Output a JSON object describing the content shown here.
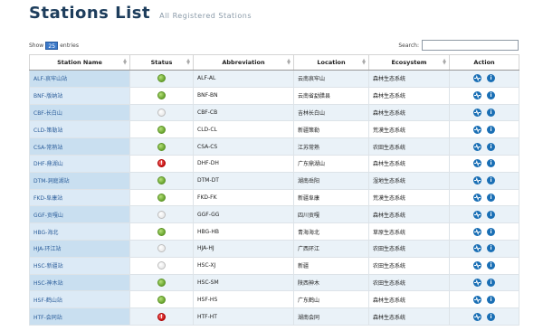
{
  "header": {
    "title": "Stations List",
    "subtitle": "All Registered Stations"
  },
  "controls": {
    "show_label": "Show",
    "page_size": "25",
    "entries_label": "entries",
    "search_label": "Search:"
  },
  "table": {
    "columns": [
      "Station Name",
      "Status",
      "Abbreviation",
      "Location",
      "Ecosystem",
      "Action"
    ],
    "rows": [
      {
        "name": "ALF-哀牢山站",
        "status": "green",
        "abbr": "ALF-AL",
        "location": "云南哀牢山",
        "ecosystem": "森林生态系统"
      },
      {
        "name": "BNF-版纳站",
        "status": "green",
        "abbr": "BNF-BN",
        "location": "云南省勐腊县",
        "ecosystem": "森林生态系统"
      },
      {
        "name": "CBF-长白山",
        "status": "empty",
        "abbr": "CBF-CB",
        "location": "吉林长白山",
        "ecosystem": "森林生态系统"
      },
      {
        "name": "CLD-策勒站",
        "status": "green",
        "abbr": "CLD-CL",
        "location": "新疆策勒",
        "ecosystem": "荒漠生态系统"
      },
      {
        "name": "CSA-常熟站",
        "status": "green",
        "abbr": "CSA-CS",
        "location": "江苏常熟",
        "ecosystem": "农田生态系统"
      },
      {
        "name": "DHF-鼎湖山",
        "status": "red",
        "abbr": "DHF-DH",
        "location": "广东鼎湖山",
        "ecosystem": "森林生态系统"
      },
      {
        "name": "DTM-洞庭湖站",
        "status": "green",
        "abbr": "DTM-DT",
        "location": "湖南岳阳",
        "ecosystem": "湿地生态系统"
      },
      {
        "name": "FKD-阜康站",
        "status": "green",
        "abbr": "FKD-FK",
        "location": "新疆阜康",
        "ecosystem": "荒漠生态系统"
      },
      {
        "name": "GGF-贡嘎山",
        "status": "empty",
        "abbr": "GGF-GG",
        "location": "四川贡嘎",
        "ecosystem": "森林生态系统"
      },
      {
        "name": "HBG-海北",
        "status": "green",
        "abbr": "HBG-HB",
        "location": "青海海北",
        "ecosystem": "草原生态系统"
      },
      {
        "name": "HJA-环江站",
        "status": "empty",
        "abbr": "HJA-HJ",
        "location": "广西环江",
        "ecosystem": "农田生态系统"
      },
      {
        "name": "HSC-新疆站",
        "status": "empty",
        "abbr": "HSC-XJ",
        "location": "新疆",
        "ecosystem": "农田生态系统"
      },
      {
        "name": "HSC-神木站",
        "status": "green",
        "abbr": "HSC-SM",
        "location": "陕西神木",
        "ecosystem": "农田生态系统"
      },
      {
        "name": "HSF-鹤山站",
        "status": "green",
        "abbr": "HSF-HS",
        "location": "广东鹤山",
        "ecosystem": "森林生态系统"
      },
      {
        "name": "HTF-会同站",
        "status": "red",
        "abbr": "HTF-HT",
        "location": "湖南会同",
        "ecosystem": "森林生态系统"
      }
    ]
  },
  "icons": {
    "status_ok": "status-ok-icon",
    "status_off": "status-off-icon",
    "status_alert": "status-alert-icon",
    "action_chart": "heartbeat-icon",
    "action_info": "info-icon"
  },
  "colors": {
    "title": "#1d3d5c",
    "link": "#2b5d9a",
    "green": "#6aa630",
    "red": "#c81414",
    "action": "#1a6fb5",
    "select": "#3b79c9"
  }
}
